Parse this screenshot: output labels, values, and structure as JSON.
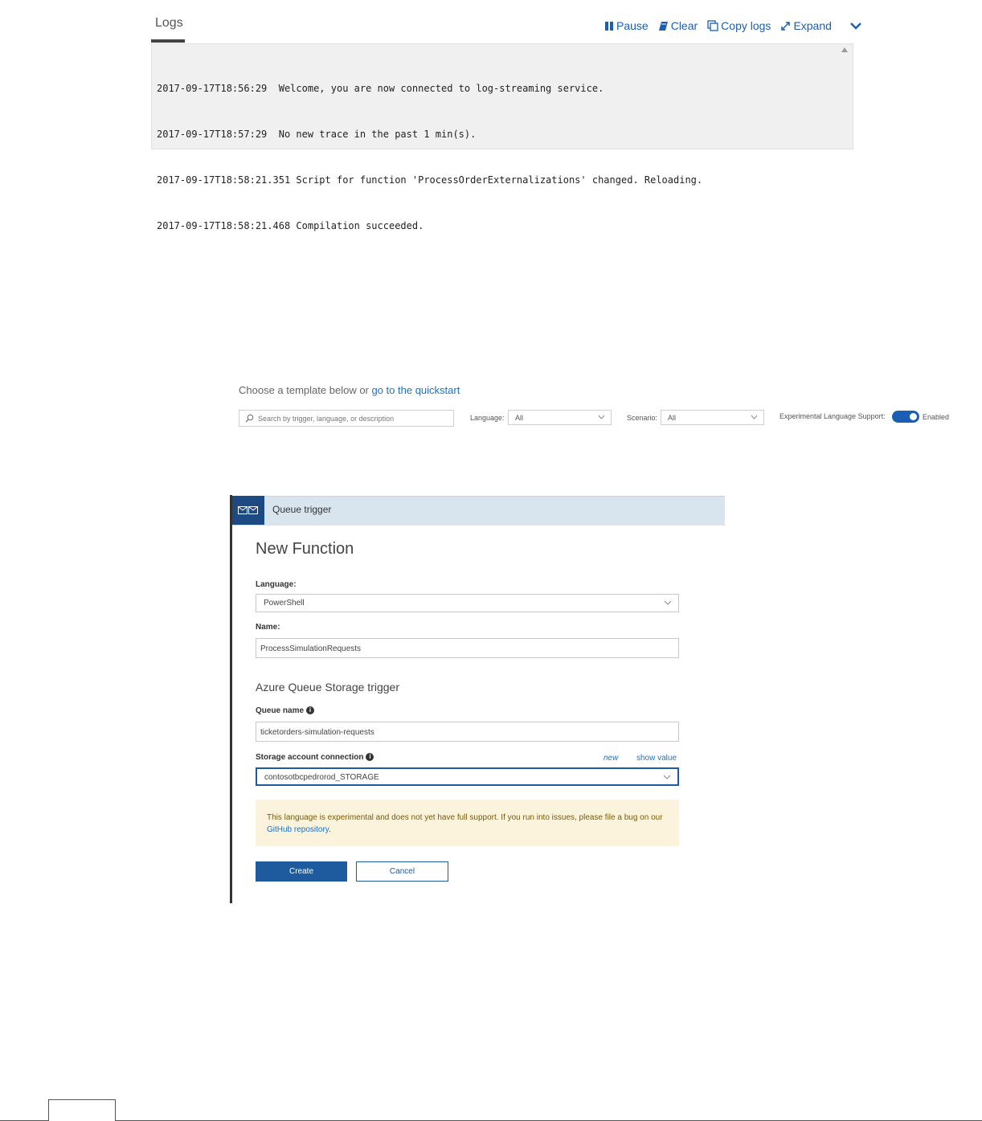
{
  "logs": {
    "tab_label": "Logs",
    "toolbar": {
      "pause_label": "Pause",
      "clear_label": "Clear",
      "copy_label": "Copy logs",
      "expand_label": "Expand"
    },
    "lines": [
      "2017-09-17T18:56:29  Welcome, you are now connected to log-streaming service.",
      "2017-09-17T18:57:29  No new trace in the past 1 min(s).",
      "2017-09-17T18:58:21.351 Script for function 'ProcessOrderExternalizations' changed. Reloading.",
      "2017-09-17T18:58:21.468 Compilation succeeded."
    ]
  },
  "template_chooser": {
    "heading_prefix": "Choose a template below or ",
    "quickstart_link": "go to the quickstart",
    "search_placeholder": "Search by trigger, language, or description",
    "language_label": "Language:",
    "language_value": "All",
    "scenario_label": "Scenario:",
    "scenario_value": "All",
    "experimental_label": "Experimental Language Support:",
    "experimental_enabled": true,
    "experimental_state": "Enabled"
  },
  "new_function": {
    "header_title": "Queue trigger",
    "title": "New Function",
    "language_label": "Language:",
    "language_value": "PowerShell",
    "name_label": "Name:",
    "name_value": "ProcessSimulationRequests",
    "section_title": "Azure Queue Storage trigger",
    "queue_name_label": "Queue name",
    "queue_name_value": "ticketorders-simulation-requests",
    "storage_label": "Storage account connection",
    "storage_new_link": "new",
    "storage_show_value_link": "show value",
    "storage_value": "contosotbcpedrorod_STORAGE",
    "warning_text": "This language is experimental and does not yet have full support. If you run into issues, please file a bug on our ",
    "warning_link": "GitHub repository",
    "warning_end": ".",
    "create_label": "Create",
    "cancel_label": "Cancel"
  },
  "colors": {
    "accent": "#1e5a9e",
    "link": "#1a73c8",
    "warning_bg": "#fbf3dc",
    "header_bg": "#d8e4ee"
  }
}
